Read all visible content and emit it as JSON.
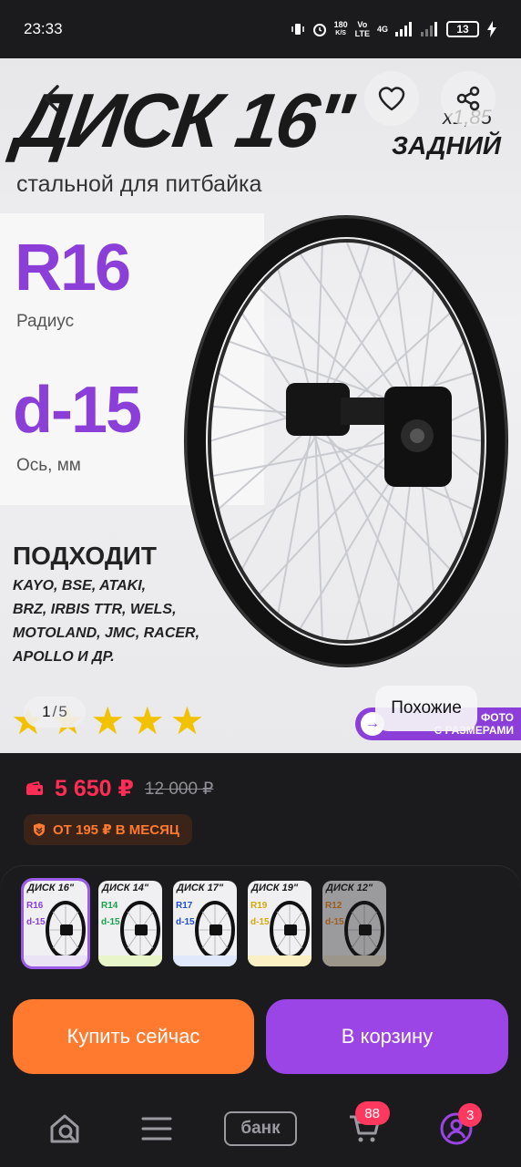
{
  "status_bar": {
    "time": "23:33",
    "net_speed_top": "180",
    "net_speed_bottom": "K/S",
    "volte_top": "Vo",
    "volte_bottom": "LTE",
    "network": "4G",
    "battery": "13"
  },
  "hero": {
    "title": "ДИСК 16\"",
    "size": "x1,85",
    "position": "ЗАДНИЙ",
    "subtitle": "стальной для питбайка",
    "radius_value": "R16",
    "radius_label": "Радиус",
    "axle_value": "d-15",
    "axle_label": "Ось, мм",
    "fits_heading": "ПОДХОДИТ",
    "fits_lines": [
      "KAYO, BSE, ATAKI,",
      "BRZ, IRBIS TTR, WELS,",
      "MOTOLAND, JMC, RACER,",
      "APOLLO И ДР."
    ],
    "rating_stars": 5
  },
  "gallery": {
    "current": "1",
    "separator": "/",
    "total": "5",
    "similar_button": "Похожие",
    "banner_line1": "ФОТО",
    "banner_line2": "С РАЗМЕРАМИ"
  },
  "price": {
    "current": "5 650 ₽",
    "old": "12 000 ₽",
    "installment": "ОТ 195 ₽ В МЕСЯЦ"
  },
  "thumbnails": [
    {
      "title": "ДИСК 16\"",
      "r": "R16",
      "d": "d-15",
      "accent": "#8b3fd8",
      "bar": "#e9e3f5"
    },
    {
      "title": "ДИСК 14\"",
      "r": "R14",
      "d": "d-15",
      "accent": "#17a34a",
      "bar": "#e8f5c8"
    },
    {
      "title": "ДИСК 17\"",
      "r": "R17",
      "d": "d-15",
      "accent": "#1d4ed8",
      "bar": "#e0e9fb"
    },
    {
      "title": "ДИСК 19\"",
      "r": "R19",
      "d": "d-15",
      "accent": "#d4a80a",
      "bar": "#faf0c4"
    },
    {
      "title": "ДИСК 12\"",
      "r": "R12",
      "d": "d-15",
      "accent": "#f08a1c",
      "bar": "#f3e6d3"
    }
  ],
  "actions": {
    "buy_now": "Купить сейчас",
    "add_to_cart": "В корзину"
  },
  "tabbar": {
    "bank_label": "банк",
    "cart_badge": "88",
    "profile_badge": "3"
  },
  "colors": {
    "accent_purple": "#9b45e6",
    "accent_orange": "#ff7a2e",
    "price_red": "#ff2d55"
  }
}
